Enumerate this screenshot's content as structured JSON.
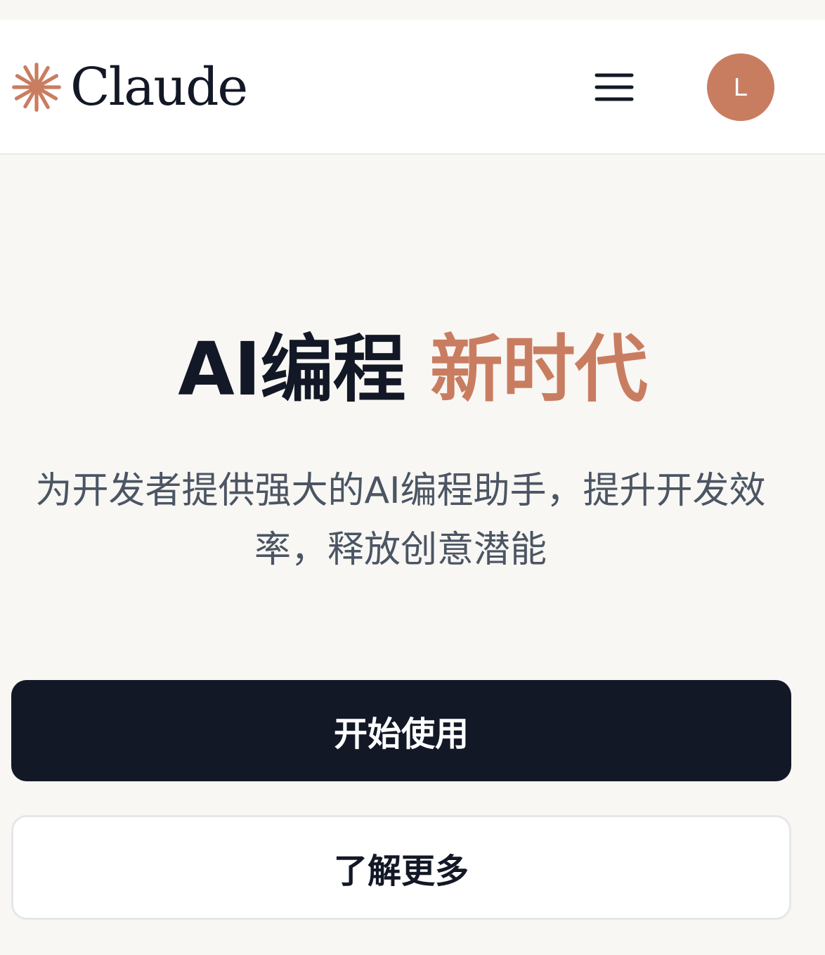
{
  "header": {
    "brand": "Claude",
    "avatar_initial": "L"
  },
  "hero": {
    "title_part1": "AI编程",
    "title_part2": "新时代",
    "subtitle": "为开发者提供强大的AI编程助手，提升开发效率，释放创意潜能"
  },
  "actions": {
    "primary_label": "开始使用",
    "secondary_label": "了解更多"
  },
  "colors": {
    "accent": "#c97d60",
    "dark": "#131826",
    "background": "#f8f7f4"
  }
}
